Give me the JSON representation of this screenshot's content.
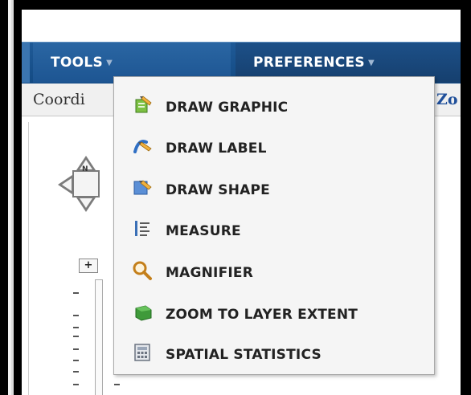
{
  "menubar": {
    "tools_label": "TOOLS",
    "preferences_label": "PREFERENCES"
  },
  "toolbar": {
    "coordinates_label": "Coordi",
    "zoom_label": "Zo"
  },
  "map": {
    "zoom_in_label": "+",
    "pan_north_label": "N"
  },
  "tools_menu": {
    "items": [
      {
        "label": "DRAW GRAPHIC",
        "icon": "draw-graphic-icon"
      },
      {
        "label": "DRAW LABEL",
        "icon": "draw-label-icon"
      },
      {
        "label": "DRAW SHAPE",
        "icon": "draw-shape-icon"
      },
      {
        "label": "MEASURE",
        "icon": "measure-icon"
      },
      {
        "label": "MAGNIFIER",
        "icon": "magnifier-icon"
      },
      {
        "label": "ZOOM TO LAYER EXTENT",
        "icon": "zoom-to-layer-extent-icon"
      },
      {
        "label": "SPATIAL STATISTICS",
        "icon": "spatial-statistics-icon"
      }
    ]
  },
  "colors": {
    "menubar": "#1b5390",
    "menu_text": "#ffffff",
    "dropdown_bg": "#f5f5f5",
    "item_text": "#222222",
    "zoom_link": "#1f4f9a"
  }
}
